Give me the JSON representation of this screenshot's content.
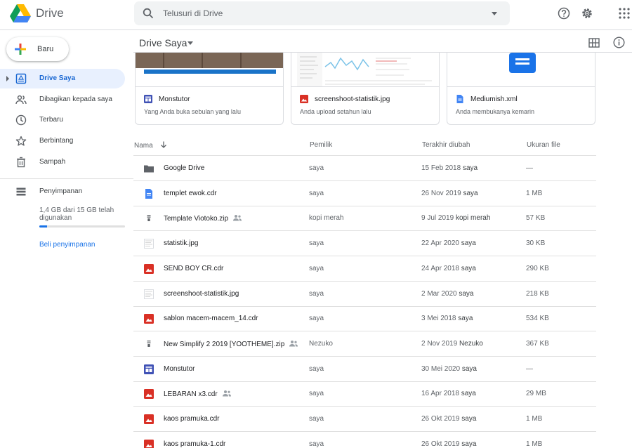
{
  "app": {
    "title": "Drive"
  },
  "search": {
    "placeholder": "Telusuri di Drive"
  },
  "sidebar": {
    "new_label": "Baru",
    "items": [
      {
        "label": "Drive Saya",
        "icon": "my-drive-icon",
        "active": true
      },
      {
        "label": "Dibagikan kepada saya",
        "icon": "people-icon"
      },
      {
        "label": "Terbaru",
        "icon": "clock-icon"
      },
      {
        "label": "Berbintang",
        "icon": "star-icon"
      },
      {
        "label": "Sampah",
        "icon": "trash-icon"
      }
    ],
    "storage": {
      "label": "Penyimpanan",
      "usage_text": "1,4 GB dari 15 GB telah digunakan",
      "used_fraction": 0.093,
      "buy_label": "Beli penyimpanan"
    }
  },
  "main": {
    "title": "Drive Saya",
    "suggested": [
      {
        "name": "Monstutor",
        "subtitle": "Yang Anda buka sebulan yang lalu",
        "icon": "sites-icon"
      },
      {
        "name": "screenshoot-statistik.jpg",
        "subtitle": "Anda upload setahun lalu",
        "icon": "image-icon"
      },
      {
        "name": "Mediumish.xml",
        "subtitle": "Anda membukanya kemarin",
        "icon": "doc-icon"
      }
    ],
    "columns": {
      "name": "Nama",
      "owner": "Pemilik",
      "modified": "Terakhir diubah",
      "size": "Ukuran file"
    },
    "files": [
      {
        "name": "Google Drive",
        "type": "folder",
        "owner": "saya",
        "date": "15 Feb 2018",
        "by": "saya",
        "size": "—",
        "shared": false
      },
      {
        "name": "templet ewok.cdr",
        "type": "doc",
        "owner": "saya",
        "date": "26 Nov 2019",
        "by": "saya",
        "size": "1 MB",
        "shared": false
      },
      {
        "name": "Template Viotoko.zip",
        "type": "zip",
        "owner": "kopi merah",
        "date": "9 Jul 2019",
        "by": "kopi merah",
        "size": "57 KB",
        "shared": true
      },
      {
        "name": "statistik.jpg",
        "type": "thumb",
        "owner": "saya",
        "date": "22 Apr 2020",
        "by": "saya",
        "size": "30 KB",
        "shared": false
      },
      {
        "name": "SEND BOY CR.cdr",
        "type": "image",
        "owner": "saya",
        "date": "24 Apr 2018",
        "by": "saya",
        "size": "290 KB",
        "shared": false
      },
      {
        "name": "screenshoot-statistik.jpg",
        "type": "thumb",
        "owner": "saya",
        "date": "2 Mar 2020",
        "by": "saya",
        "size": "218 KB",
        "shared": false
      },
      {
        "name": "sablon macem-macem_14.cdr",
        "type": "image",
        "owner": "saya",
        "date": "3 Mei 2018",
        "by": "saya",
        "size": "534 KB",
        "shared": false
      },
      {
        "name": "New Simplify 2 2019 [YOOTHEME].zip",
        "type": "zip",
        "owner": "Nezuko",
        "date": "2 Nov 2019",
        "by": "Nezuko",
        "size": "367 KB",
        "shared": true
      },
      {
        "name": "Monstutor",
        "type": "sites",
        "owner": "saya",
        "date": "30 Mei 2020",
        "by": "saya",
        "size": "—",
        "shared": false
      },
      {
        "name": "LEBARAN x3.cdr",
        "type": "image",
        "owner": "saya",
        "date": "16 Apr 2018",
        "by": "saya",
        "size": "29 MB",
        "shared": true
      },
      {
        "name": "kaos pramuka.cdr",
        "type": "image",
        "owner": "saya",
        "date": "26 Okt 2019",
        "by": "saya",
        "size": "1 MB",
        "shared": false
      },
      {
        "name": "kaos pramuka-1.cdr",
        "type": "image",
        "owner": "saya",
        "date": "26 Okt 2019",
        "by": "saya",
        "size": "1 MB",
        "shared": false
      }
    ]
  },
  "colors": {
    "accent": "#1a73e8",
    "active_bg": "#e8f0fe",
    "image_red": "#d93025",
    "doc_blue": "#4285f4",
    "sites_blue": "#3f51b5"
  }
}
